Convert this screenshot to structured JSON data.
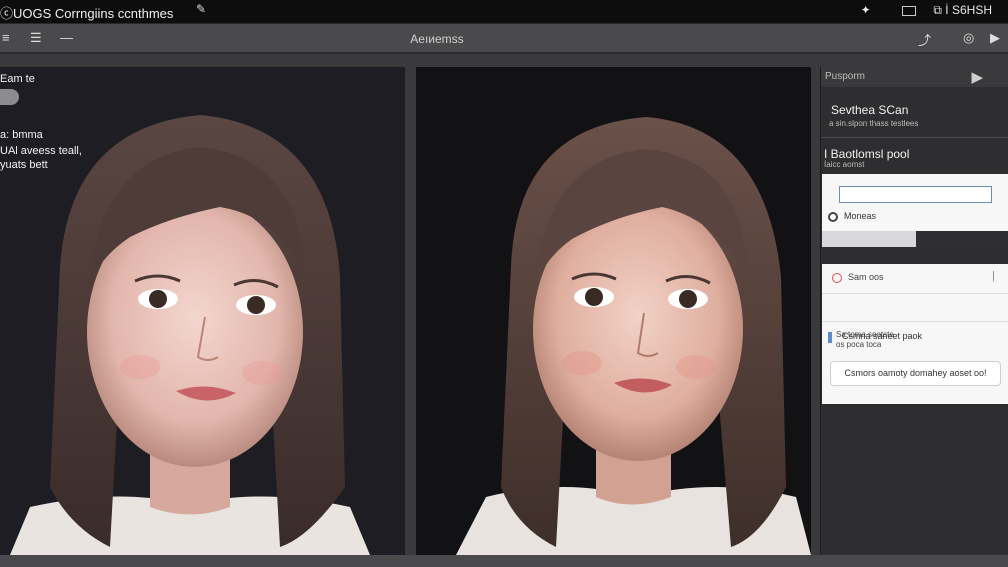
{
  "titlebar": {
    "app_title": "ⓒUOGS Corrngiins ccnthmes",
    "pen_icon": "pen-icon",
    "right_items": [
      "✦",
      "▭",
      "⧉ İ S6HSH"
    ]
  },
  "toolbar": {
    "btn1": "≡",
    "btn2": "☰",
    "btn3": "—",
    "title": "Aeıᴎemss",
    "right_btn1": "⤴",
    "right_btn2": "◎",
    "right_btn3": "▶"
  },
  "left_pane": {
    "line1": "Eam te",
    "line2": "a: bmma",
    "line3": "UAl aveess teall,",
    "line4": "yuats bett"
  },
  "sidebar": {
    "header_label": "Pusporm",
    "title": "Sevthea SCan",
    "subtitle": "a sin.slpon thass testlees",
    "section_title": "I Baotlomsl pool",
    "section_sub": "İaicc aomst",
    "field_value": "",
    "radio_label": "Moneas",
    "row1_label": "Sam oos",
    "row2_label": "Csmna saneet paok",
    "desc": "Sa.toma sootste\nos poca toca",
    "button_label": "Csmors oamoty domahey aoset oo!",
    "colors": {
      "accent": "#5b8bd6",
      "danger": "#d9534f"
    }
  }
}
